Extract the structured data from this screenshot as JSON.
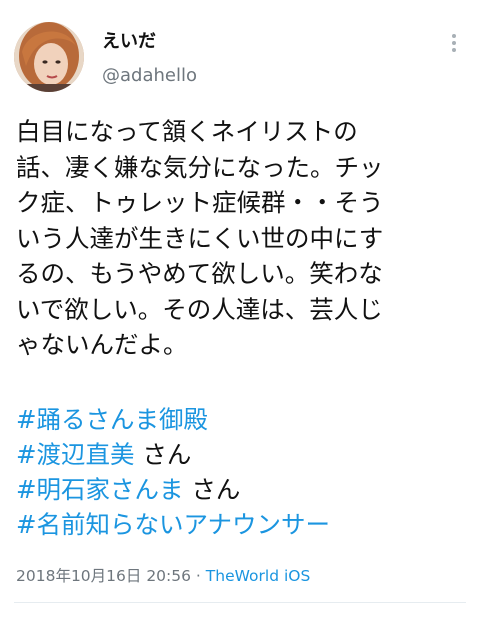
{
  "tweet": {
    "display_name": "えいだ",
    "username": "@adahello",
    "body_lines": [
      "白目になって頷くネイリストの",
      "話、凄く嫌な気分になった。チッ",
      "ク症、トゥレット症候群・・そう",
      "いう人達が生きにくい世の中にす",
      "るの、もうやめて欲しい。笑わな",
      "いで欲しい。その人達は、芸人じ",
      "ゃないんだよ。"
    ],
    "hashtags": [
      {
        "tag": "#踊るさんま御殿",
        "suffix": ""
      },
      {
        "tag": "#渡辺直美",
        "suffix": " さん"
      },
      {
        "tag": "#明石家さんま",
        "suffix": " さん"
      },
      {
        "tag": "#名前知らないアナウンサー",
        "suffix": ""
      }
    ],
    "timestamp": "2018年10月16日 20:56",
    "separator": " · ",
    "source": "TheWorld iOS"
  },
  "icons": {
    "more": "more-vertical-icon",
    "avatar": "profile-photo"
  },
  "colors": {
    "link": "#1b95e0",
    "text": "#111111",
    "muted": "#6e767d",
    "divider": "#e6ecf0"
  }
}
